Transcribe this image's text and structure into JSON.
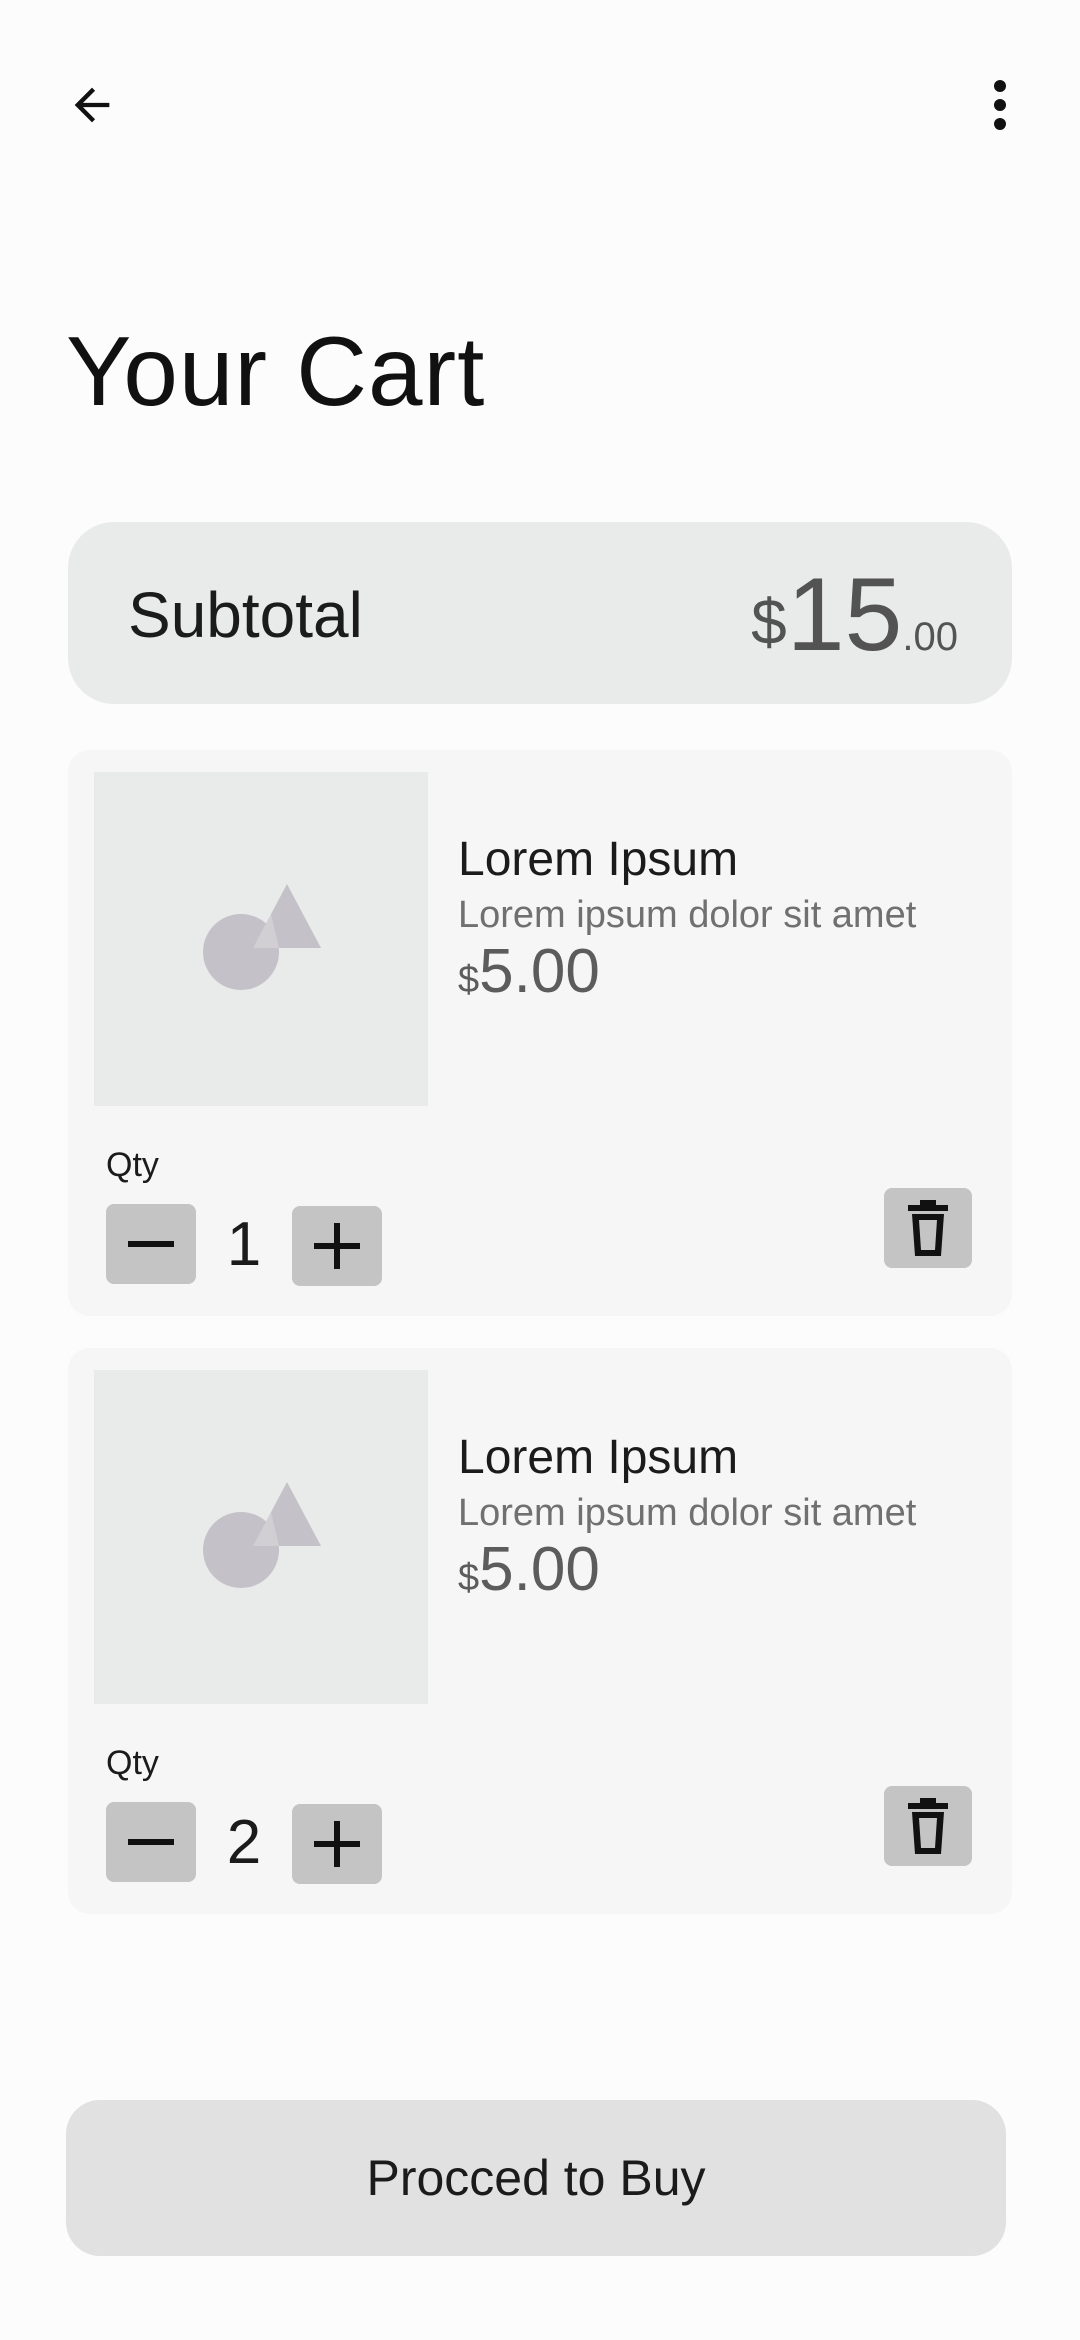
{
  "header": {
    "back_icon": "arrow-left-icon",
    "menu_icon": "more-vert-icon"
  },
  "page": {
    "title": "Your Cart"
  },
  "subtotal": {
    "label": "Subtotal",
    "currency": "$",
    "whole": "15",
    "cents": ".00"
  },
  "cart": {
    "items": [
      {
        "name": "Lorem Ipsum",
        "description": "Lorem ipsum dolor sit amet",
        "currency": "$",
        "price": "5.00",
        "qty_label": "Qty",
        "qty": "1",
        "image_icon": "image-placeholder-icon"
      },
      {
        "name": "Lorem Ipsum",
        "description": "Lorem ipsum dolor sit amet",
        "currency": "$",
        "price": "5.00",
        "qty_label": "Qty",
        "qty": "2",
        "image_icon": "image-placeholder-icon"
      }
    ]
  },
  "footer": {
    "buy_label": "Procced to Buy"
  },
  "colors": {
    "background": "#fdfcfd",
    "subtotal_bg": "#e9eaea",
    "card_bg": "#f6f6f6",
    "button_bg": "#c4c4c4",
    "buy_button_bg": "#e1e1e1",
    "placeholder_shape": "#c5c1c8"
  }
}
